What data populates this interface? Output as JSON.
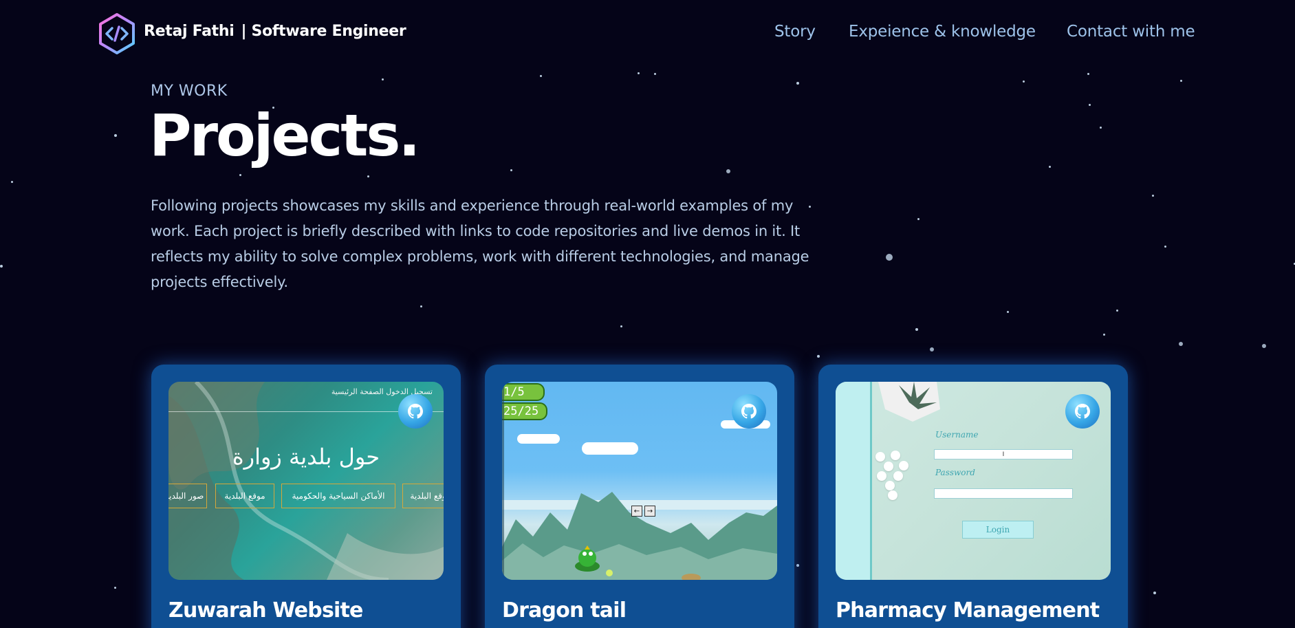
{
  "brand": {
    "name": "Retaj Fathi",
    "separator": "|",
    "role": "Software Engineer"
  },
  "nav": {
    "items": [
      "Story",
      "Expeience & knowledge",
      "Contact with me"
    ]
  },
  "intro": {
    "eyebrow": "MY WORK",
    "title": "Projects.",
    "description": "Following projects showcases my skills and experience through real-world examples of my work. Each project is briefly described with links to code repositories and live demos in it. It reflects my ability to solve complex problems, work with different technologies, and manage projects effectively."
  },
  "projects": [
    {
      "name": "Zuwarah Website",
      "icon": "github-icon",
      "preview": {
        "nav_text": "تسجيل الدخول  الصفحة الرئيسية",
        "heading": "حول بلدية زوارة",
        "buttons": [
          "صور البلدية",
          "موقع البلدية",
          "الأماكن السياحية والحكومية",
          "موقع البلدية"
        ]
      }
    },
    {
      "name": "Dragon tail",
      "icon": "github-icon",
      "preview": {
        "hud_top": "1/5",
        "hud_bottom": "25/25"
      }
    },
    {
      "name": "Pharmacy Management",
      "icon": "github-icon",
      "preview": {
        "username_label": "Username",
        "username_value": "I",
        "password_label": "Password",
        "login_label": "Login"
      }
    }
  ],
  "colors": {
    "background": "#050418",
    "card": "#0f4f93",
    "nav_link": "#9ec3ea",
    "text_muted": "#b9cde6"
  }
}
